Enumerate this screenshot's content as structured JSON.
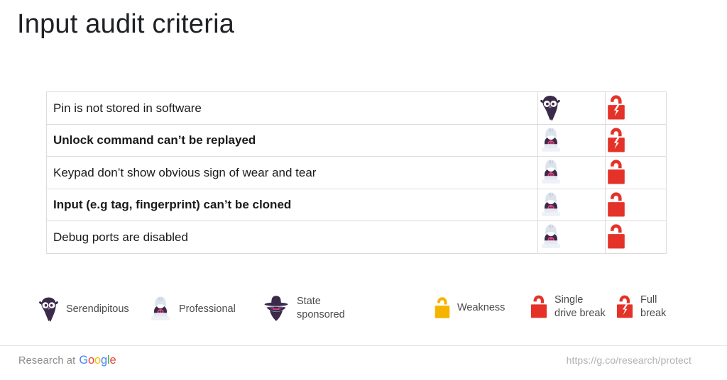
{
  "slide": {
    "title": "Input audit criteria"
  },
  "table": {
    "rows": [
      {
        "criterion": "Pin is not stored in software",
        "bold": false,
        "actor": "serendipitous-icon",
        "lock": "full-break-icon"
      },
      {
        "criterion": "Unlock command can’t be replayed",
        "bold": true,
        "actor": "professional-icon",
        "lock": "full-break-icon"
      },
      {
        "criterion": "Keypad don’t show obvious sign of wear and tear",
        "bold": false,
        "actor": "professional-icon",
        "lock": "single-drive-break-icon"
      },
      {
        "criterion": "Input (e.g tag, fingerprint) can’t be cloned",
        "bold": true,
        "actor": "professional-icon",
        "lock": "single-drive-break-icon"
      },
      {
        "criterion": "Debug ports are disabled",
        "bold": false,
        "actor": "professional-icon",
        "lock": "single-drive-break-icon"
      }
    ]
  },
  "legend": {
    "items": [
      {
        "label": "Serendipitous",
        "icon": "serendipitous-icon"
      },
      {
        "label": "Professional",
        "icon": "professional-icon"
      },
      {
        "label": "State\nsponsored",
        "icon": "state-sponsored-icon"
      },
      {
        "label": "Weakness",
        "icon": "weakness-lock-icon"
      },
      {
        "label": "Single\ndrive break",
        "icon": "single-drive-break-icon"
      },
      {
        "label": "Full\nbreak",
        "icon": "full-break-icon"
      }
    ]
  },
  "footer": {
    "brand_prefix": "Research at",
    "brand_google": [
      "G",
      "o",
      "o",
      "g",
      "l",
      "e"
    ],
    "url": "https://g.co/research/protect"
  },
  "colors": {
    "lock_red": "#E53228",
    "lock_yellow": "#F5B400",
    "actor_dark": "#3B2A4A",
    "actor_hood": "#DCE3EC",
    "skull_pink": "#E0447F",
    "rule": "#dcdcdc",
    "text": "#202124"
  }
}
